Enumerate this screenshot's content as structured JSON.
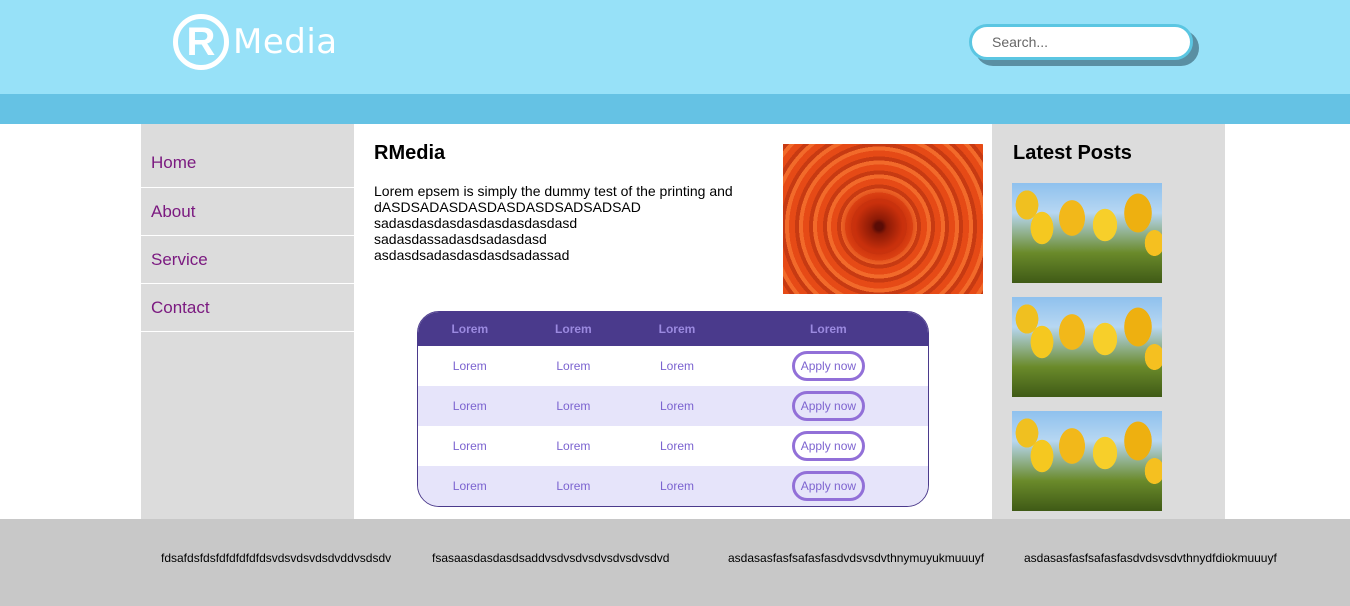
{
  "header": {
    "logo_mark": "R",
    "logo_text": "Media",
    "search_placeholder": "Search..."
  },
  "sidebar": {
    "items": [
      {
        "label": "Home"
      },
      {
        "label": "About"
      },
      {
        "label": "Service"
      },
      {
        "label": "Contact"
      }
    ]
  },
  "main": {
    "title": "RMedia",
    "paragraph_lines": [
      "Lorem epsem is simply the dummy test of the printing and",
      "dASDSADASDASDASDASDSADSADSAD",
      "sadasdasdasdasdasdasdasdasd",
      "sadasdassadasdsadasdasd",
      "asdasdsadasdasdasdsadassad"
    ],
    "table": {
      "headers": [
        "Lorem",
        "Lorem",
        "Lorem",
        "Lorem"
      ],
      "rows": [
        {
          "cells": [
            "Lorem",
            "Lorem",
            "Lorem"
          ],
          "action": "Apply now"
        },
        {
          "cells": [
            "Lorem",
            "Lorem",
            "Lorem"
          ],
          "action": "Apply now"
        },
        {
          "cells": [
            "Lorem",
            "Lorem",
            "Lorem"
          ],
          "action": "Apply now"
        },
        {
          "cells": [
            "Lorem",
            "Lorem",
            "Lorem"
          ],
          "action": "Apply now"
        }
      ]
    }
  },
  "right": {
    "title": "Latest Posts"
  },
  "footer": {
    "items": [
      "fdsafdsfdsfdfdfdfdfdsvdsvdsvdsdvddvsdsdv",
      "fsasaasdasdasdsaddvsdvsdvsdvsdvsdvsdvd",
      "asdasasfasfsafasfasdvdsvsdvthnymuyukmuuuyf",
      "asdasasfasfsafasfasdvdsvsdvthnydfdiokmuuuyf"
    ]
  },
  "colors": {
    "header_bg": "#97e1f8",
    "nav_strip": "#65c2e4",
    "sidebar_bg": "#dcdcdc",
    "link_color": "#7b1a80",
    "table_header_bg": "#4a3a8c",
    "table_alt_row": "#e6e4fa",
    "footer_bg": "#c8c8c8"
  }
}
